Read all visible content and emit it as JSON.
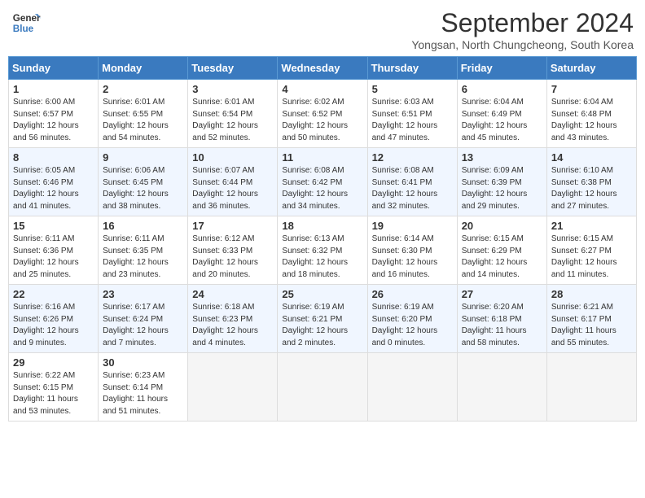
{
  "header": {
    "logo_line1": "General",
    "logo_line2": "Blue",
    "month_year": "September 2024",
    "location": "Yongsan, North Chungcheong, South Korea"
  },
  "days_of_week": [
    "Sunday",
    "Monday",
    "Tuesday",
    "Wednesday",
    "Thursday",
    "Friday",
    "Saturday"
  ],
  "weeks": [
    [
      {
        "day": "1",
        "sunrise": "6:00 AM",
        "sunset": "6:57 PM",
        "daylight": "12 hours and 56 minutes."
      },
      {
        "day": "2",
        "sunrise": "6:01 AM",
        "sunset": "6:55 PM",
        "daylight": "12 hours and 54 minutes."
      },
      {
        "day": "3",
        "sunrise": "6:01 AM",
        "sunset": "6:54 PM",
        "daylight": "12 hours and 52 minutes."
      },
      {
        "day": "4",
        "sunrise": "6:02 AM",
        "sunset": "6:52 PM",
        "daylight": "12 hours and 50 minutes."
      },
      {
        "day": "5",
        "sunrise": "6:03 AM",
        "sunset": "6:51 PM",
        "daylight": "12 hours and 47 minutes."
      },
      {
        "day": "6",
        "sunrise": "6:04 AM",
        "sunset": "6:49 PM",
        "daylight": "12 hours and 45 minutes."
      },
      {
        "day": "7",
        "sunrise": "6:04 AM",
        "sunset": "6:48 PM",
        "daylight": "12 hours and 43 minutes."
      }
    ],
    [
      {
        "day": "8",
        "sunrise": "6:05 AM",
        "sunset": "6:46 PM",
        "daylight": "12 hours and 41 minutes."
      },
      {
        "day": "9",
        "sunrise": "6:06 AM",
        "sunset": "6:45 PM",
        "daylight": "12 hours and 38 minutes."
      },
      {
        "day": "10",
        "sunrise": "6:07 AM",
        "sunset": "6:44 PM",
        "daylight": "12 hours and 36 minutes."
      },
      {
        "day": "11",
        "sunrise": "6:08 AM",
        "sunset": "6:42 PM",
        "daylight": "12 hours and 34 minutes."
      },
      {
        "day": "12",
        "sunrise": "6:08 AM",
        "sunset": "6:41 PM",
        "daylight": "12 hours and 32 minutes."
      },
      {
        "day": "13",
        "sunrise": "6:09 AM",
        "sunset": "6:39 PM",
        "daylight": "12 hours and 29 minutes."
      },
      {
        "day": "14",
        "sunrise": "6:10 AM",
        "sunset": "6:38 PM",
        "daylight": "12 hours and 27 minutes."
      }
    ],
    [
      {
        "day": "15",
        "sunrise": "6:11 AM",
        "sunset": "6:36 PM",
        "daylight": "12 hours and 25 minutes."
      },
      {
        "day": "16",
        "sunrise": "6:11 AM",
        "sunset": "6:35 PM",
        "daylight": "12 hours and 23 minutes."
      },
      {
        "day": "17",
        "sunrise": "6:12 AM",
        "sunset": "6:33 PM",
        "daylight": "12 hours and 20 minutes."
      },
      {
        "day": "18",
        "sunrise": "6:13 AM",
        "sunset": "6:32 PM",
        "daylight": "12 hours and 18 minutes."
      },
      {
        "day": "19",
        "sunrise": "6:14 AM",
        "sunset": "6:30 PM",
        "daylight": "12 hours and 16 minutes."
      },
      {
        "day": "20",
        "sunrise": "6:15 AM",
        "sunset": "6:29 PM",
        "daylight": "12 hours and 14 minutes."
      },
      {
        "day": "21",
        "sunrise": "6:15 AM",
        "sunset": "6:27 PM",
        "daylight": "12 hours and 11 minutes."
      }
    ],
    [
      {
        "day": "22",
        "sunrise": "6:16 AM",
        "sunset": "6:26 PM",
        "daylight": "12 hours and 9 minutes."
      },
      {
        "day": "23",
        "sunrise": "6:17 AM",
        "sunset": "6:24 PM",
        "daylight": "12 hours and 7 minutes."
      },
      {
        "day": "24",
        "sunrise": "6:18 AM",
        "sunset": "6:23 PM",
        "daylight": "12 hours and 4 minutes."
      },
      {
        "day": "25",
        "sunrise": "6:19 AM",
        "sunset": "6:21 PM",
        "daylight": "12 hours and 2 minutes."
      },
      {
        "day": "26",
        "sunrise": "6:19 AM",
        "sunset": "6:20 PM",
        "daylight": "12 hours and 0 minutes."
      },
      {
        "day": "27",
        "sunrise": "6:20 AM",
        "sunset": "6:18 PM",
        "daylight": "11 hours and 58 minutes."
      },
      {
        "day": "28",
        "sunrise": "6:21 AM",
        "sunset": "6:17 PM",
        "daylight": "11 hours and 55 minutes."
      }
    ],
    [
      {
        "day": "29",
        "sunrise": "6:22 AM",
        "sunset": "6:15 PM",
        "daylight": "11 hours and 53 minutes."
      },
      {
        "day": "30",
        "sunrise": "6:23 AM",
        "sunset": "6:14 PM",
        "daylight": "11 hours and 51 minutes."
      },
      null,
      null,
      null,
      null,
      null
    ]
  ]
}
